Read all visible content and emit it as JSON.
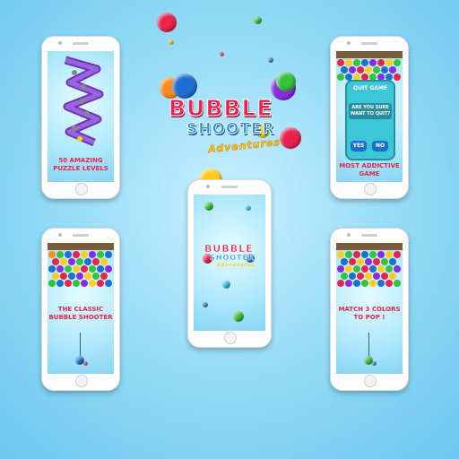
{
  "logo": {
    "line1": "BUBBLE",
    "line2": "SHOOTER",
    "line3": "Adventures"
  },
  "phones": [
    {
      "id": "levels",
      "caption": "50 AMAZING\nPUZZLE LEVELS"
    },
    {
      "id": "quit",
      "caption": "MOST ADDICTIVE\nGAME",
      "dialog": {
        "title": "QUIT GAME",
        "question": "ARE YOU SURE\nWANT TO QUIT?",
        "yes": "YES",
        "no": "NO"
      }
    },
    {
      "id": "splash",
      "caption": ""
    },
    {
      "id": "classic",
      "caption": "THE CLASSIC\nBUBBLE SHOOTER"
    },
    {
      "id": "match",
      "caption": "MATCH 3 COLORS\nTO POP !"
    }
  ],
  "colors": {
    "red": "#e8244e",
    "blue": "#1f6fd1",
    "yellow": "#ffcd1f",
    "green": "#37c23b",
    "purple": "#8a2be2",
    "orange": "#ff8a1e",
    "cyan": "#24c3e8"
  }
}
